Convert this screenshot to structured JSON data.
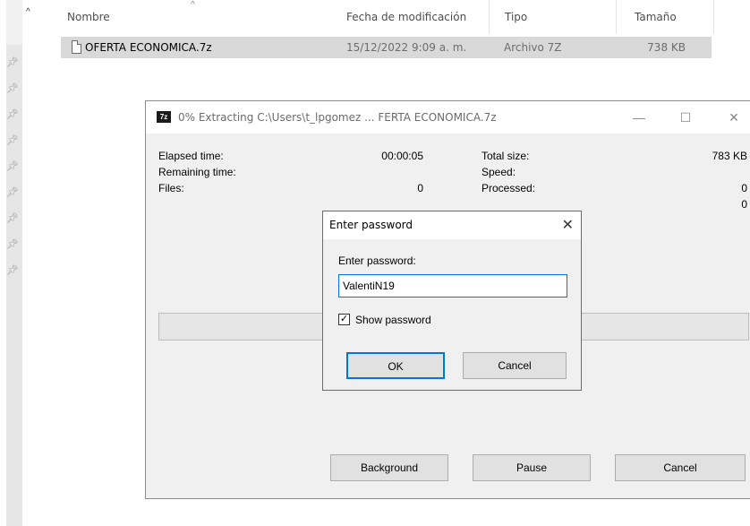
{
  "explorer": {
    "columns": {
      "name": "Nombre",
      "modified": "Fecha de modificación",
      "type": "Tipo",
      "size": "Tamaño"
    },
    "file": {
      "name": "OFERTA ECONOMICA.7z",
      "modified": "15/12/2022 9:09 a. m.",
      "type": "Archivo 7Z",
      "size": "738 KB"
    },
    "icons": [
      "pin-icon",
      "file-icon",
      "chevron-up-icon"
    ]
  },
  "extract_window": {
    "title": "0% Extracting C:\\Users\\t_lpgomez ... FERTA ECONOMICA.7z",
    "app_icon_text": "7z",
    "controls": {
      "minimize": "—",
      "maximize": "☐",
      "close": "✕"
    },
    "left_stats": [
      {
        "label": "Elapsed time:",
        "value": "00:00:05"
      },
      {
        "label": "Remaining time:",
        "value": ""
      },
      {
        "label": "Files:",
        "value": "0"
      }
    ],
    "right_stats": [
      {
        "label": "Total size:",
        "value": "783 KB"
      },
      {
        "label": "Speed:",
        "value": ""
      },
      {
        "label": "Processed:",
        "value": "0"
      },
      {
        "label": "",
        "value": "0"
      }
    ],
    "progress_percent": 0,
    "buttons": {
      "background": "Background",
      "pause": "Pause",
      "cancel": "Cancel"
    }
  },
  "password_dialog": {
    "title": "Enter password",
    "close": "✕",
    "prompt": "Enter password:",
    "value": "ValentiN19",
    "show_password_label": "Show password",
    "show_password_checked": true,
    "ok_label": "OK",
    "cancel_label": "Cancel",
    "accent_color": "#0078d7"
  }
}
